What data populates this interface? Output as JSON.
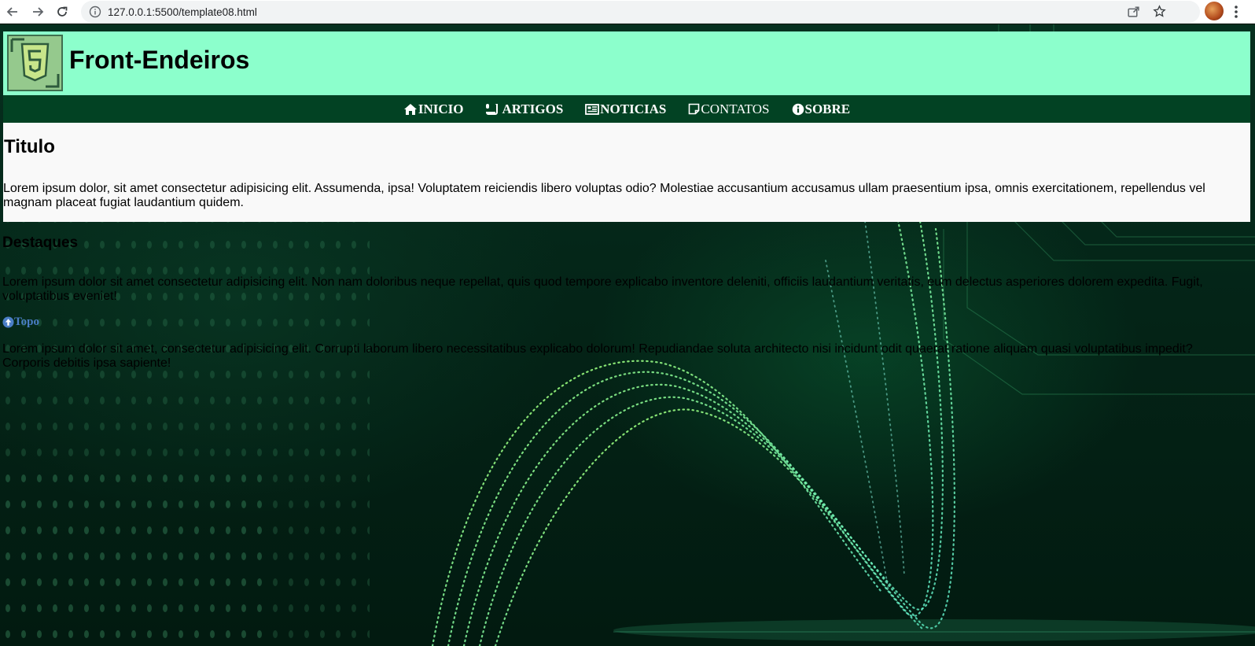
{
  "browser": {
    "url": "127.0.0.1:5500/template08.html"
  },
  "header": {
    "title": "Front-Endeiros"
  },
  "nav": {
    "items": [
      {
        "label": "INICIO",
        "icon": "home-icon"
      },
      {
        "label": "ARTIGOS",
        "icon": "scroll-icon"
      },
      {
        "label": "NOTICIAS",
        "icon": "newspaper-icon"
      },
      {
        "label": "CONTATOS",
        "icon": "note-icon"
      },
      {
        "label": "SOBRE",
        "icon": "info-circle-icon"
      }
    ]
  },
  "main": {
    "title": "Titulo",
    "text": "Lorem ipsum dolor, sit amet consectetur adipisicing elit. Assumenda, ipsa! Voluptatem reiciendis libero voluptas odio? Molestiae accusantium accusamus ullam praesentium ipsa, omnis exercitationem, repellendus vel magnam placeat fugiat laudantium quidem."
  },
  "destaques": {
    "title": "Destaques",
    "text1": "Lorem ipsum dolor sit amet consectetur adipisicing elit. Non nam doloribus neque repellat, quis quod tempore explicabo inventore deleniti, officiis laudantium veritatis, eum delectus asperiores dolorem expedita. Fugit, voluptatibus eveniet!",
    "top_link": "Topo",
    "text2": "Lorem ipsum dolor sit amet, consectetur adipisicing elit. Corrupti laborum libero necessitatibus explicabo dolorum! Repudiandae soluta architecto nisi incidunt odit quaerat ratione aliquam quasi voluptatibus impedit? Corporis debitis ipsa sapiente!"
  },
  "colors": {
    "header_bg": "#8cffcc",
    "nav_bg": "#024223",
    "link": "#4a7ec6"
  }
}
